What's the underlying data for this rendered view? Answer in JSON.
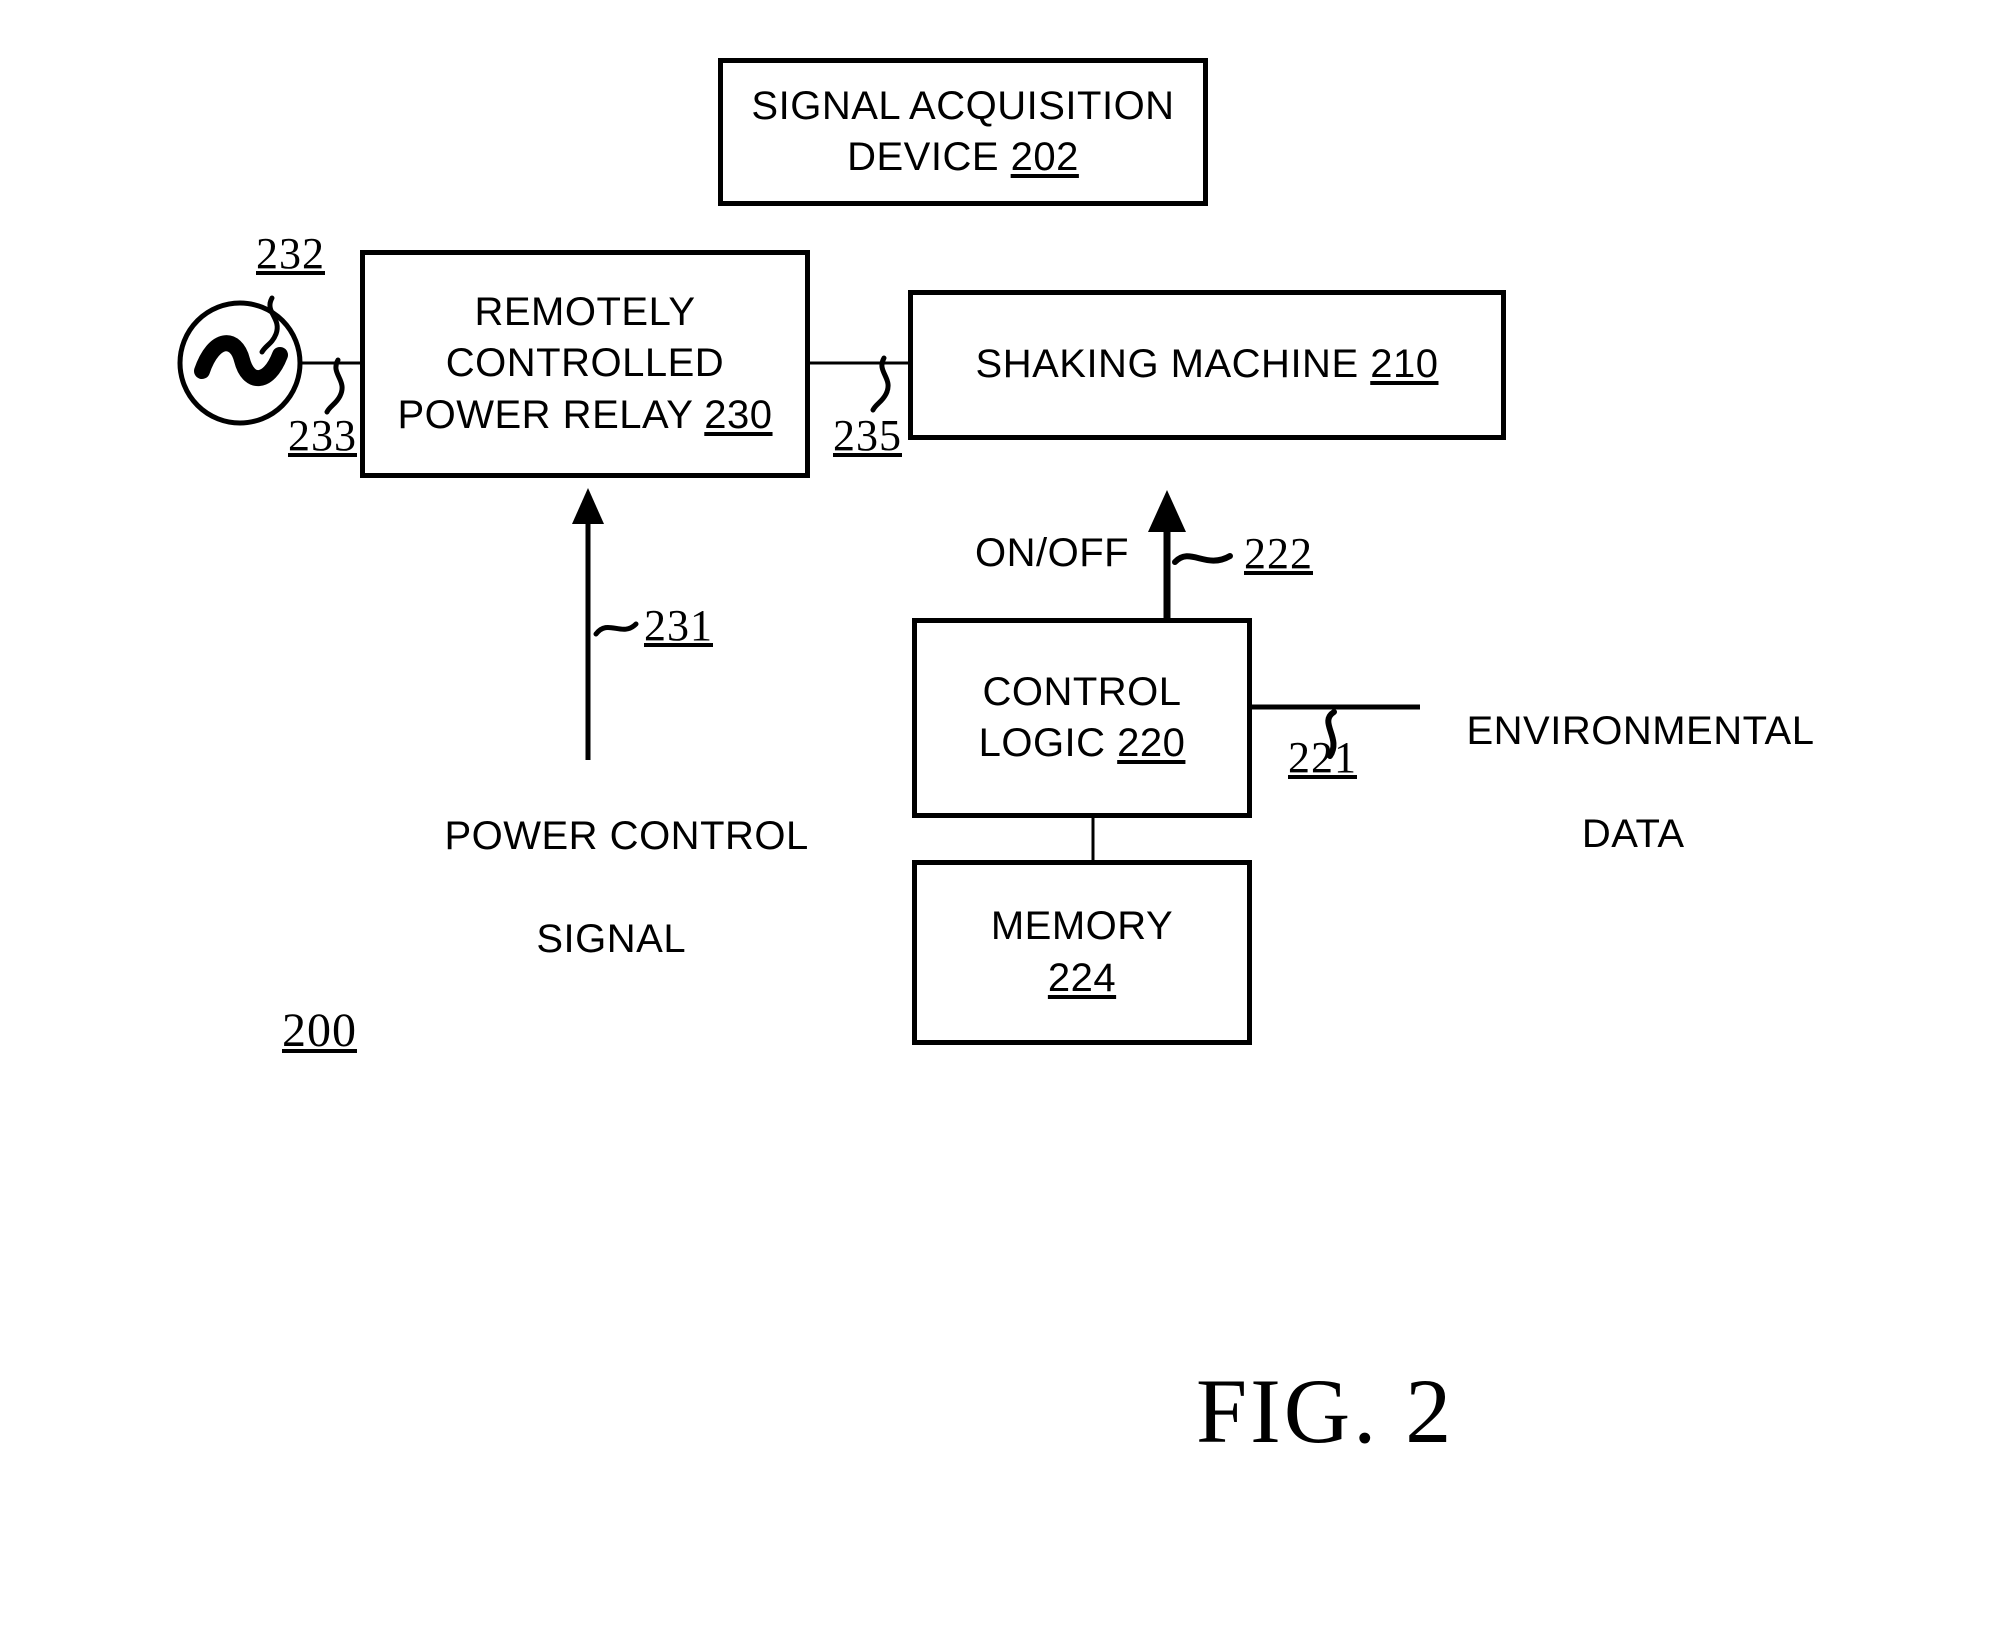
{
  "figure": {
    "caption": "FIG. 2",
    "system_ref": "200"
  },
  "boxes": [
    {
      "id": "signal-acquisition-device",
      "line1": "SIGNAL ACQUISITION",
      "line2_text": "DEVICE ",
      "line2_ref": "202"
    },
    {
      "id": "remotely-controlled-power-relay",
      "line1": "REMOTELY",
      "line2": "CONTROLLED",
      "line3_text": "POWER RELAY ",
      "line3_ref": "230"
    },
    {
      "id": "shaking-machine",
      "line1_text": "SHAKING MACHINE ",
      "line1_ref": "210"
    },
    {
      "id": "control-logic",
      "line1": "CONTROL",
      "line2_text": "LOGIC ",
      "line2_ref": "220"
    },
    {
      "id": "memory",
      "line1": "MEMORY",
      "line2_ref": "224"
    }
  ],
  "labels": {
    "power_source_ref": "232",
    "source_to_relay_ref": "233",
    "relay_to_shaker_ref": "235",
    "power_control_ref": "231",
    "power_control_line1": "POWER CONTROL",
    "power_control_line2": "SIGNAL",
    "onoff_label": "ON/OFF",
    "onoff_ref": "222",
    "env_data_ref": "221",
    "env_data_line1": "ENVIRONMENTAL",
    "env_data_line2": "DATA"
  },
  "icons": {
    "ac_source": "ac-power-source-icon"
  },
  "colors": {
    "stroke": "#000000",
    "background": "#ffffff"
  }
}
